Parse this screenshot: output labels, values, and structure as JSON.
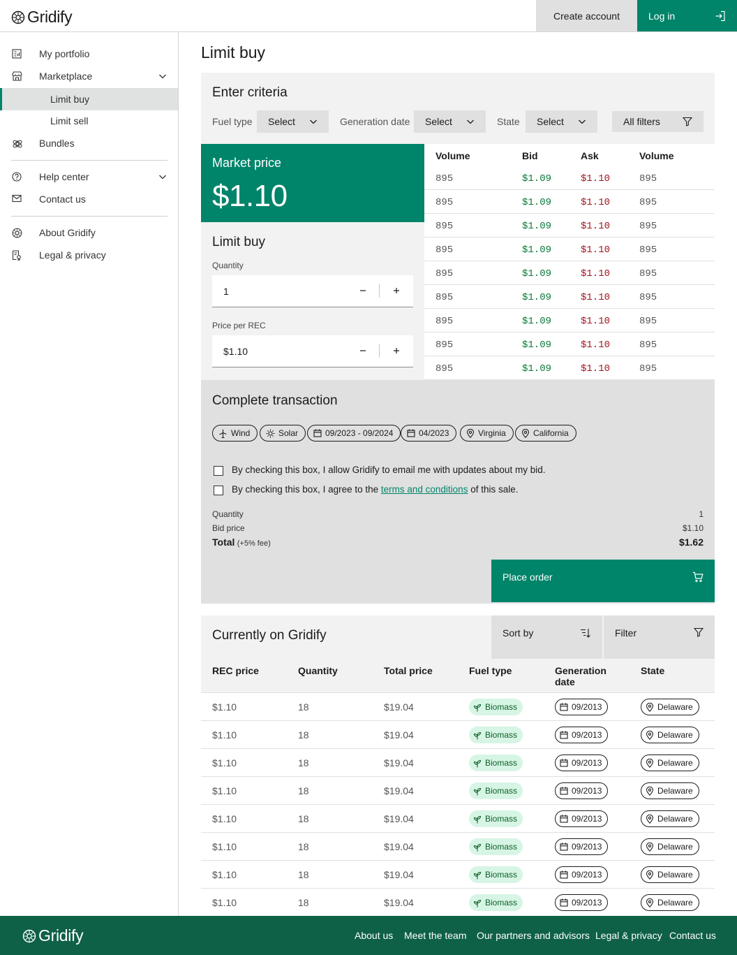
{
  "header": {
    "brand": "Gridify",
    "create_account": "Create account",
    "login": "Log in"
  },
  "sidebar": {
    "items": [
      {
        "label": "My portfolio",
        "icon": "portfolio-icon"
      },
      {
        "label": "Marketplace",
        "icon": "storefront-icon"
      },
      {
        "label": "Limit buy"
      },
      {
        "label": "Limit sell"
      },
      {
        "label": "Bundles",
        "icon": "bundles-icon"
      },
      {
        "label": "Help center",
        "icon": "help-icon"
      },
      {
        "label": "Contact us",
        "icon": "mail-icon"
      },
      {
        "label": "About Gridify",
        "icon": "gridify-logo-icon"
      },
      {
        "label": "Legal & privacy",
        "icon": "legal-icon"
      }
    ]
  },
  "page": {
    "title": "Limit buy"
  },
  "criteria": {
    "title": "Enter criteria",
    "fuel_label": "Fuel type",
    "gen_label": "Generation date",
    "state_label": "State",
    "select_text": "Select",
    "all_filters": "All filters"
  },
  "market": {
    "title": "Market price",
    "price": "$1.10"
  },
  "limit_buy": {
    "title": "Limit buy",
    "quantity_label": "Quantity",
    "quantity_value": "1",
    "price_label": "Price per REC",
    "price_value": "$1.10"
  },
  "order_book": {
    "headers": [
      "Volume",
      "Bid",
      "Ask",
      "Volume"
    ],
    "rows": [
      [
        "895",
        "$1.09",
        "$1.10",
        "895"
      ],
      [
        "895",
        "$1.09",
        "$1.10",
        "895"
      ],
      [
        "895",
        "$1.09",
        "$1.10",
        "895"
      ],
      [
        "895",
        "$1.09",
        "$1.10",
        "895"
      ],
      [
        "895",
        "$1.09",
        "$1.10",
        "895"
      ],
      [
        "895",
        "$1.09",
        "$1.10",
        "895"
      ],
      [
        "895",
        "$1.09",
        "$1.10",
        "895"
      ],
      [
        "895",
        "$1.09",
        "$1.10",
        "895"
      ],
      [
        "895",
        "$1.09",
        "$1.10",
        "895"
      ]
    ]
  },
  "transaction": {
    "title": "Complete transaction",
    "tags": [
      "Wind",
      "Solar",
      "09/2023 - 09/2024",
      "04/2023",
      "Virginia",
      "California"
    ],
    "check_email": "By checking this box, I allow Gridify to email me with updates about my bid.",
    "check_terms_pre": "By checking this box, I agree to the ",
    "check_terms_link": "terms and conditions",
    "check_terms_post": " of this sale.",
    "quantity_label": "Quantity",
    "quantity_value": "1",
    "bid_label": "Bid price",
    "bid_value": "$1.10",
    "total_label": "Total",
    "fee_note": "(+5% fee)",
    "total_value": "$1.62",
    "place_order": "Place order"
  },
  "listing": {
    "title": "Currently on Gridify",
    "sort_by": "Sort by",
    "filter": "Filter",
    "headers": [
      "REC price",
      "Quantity",
      "Total price",
      "Fuel type",
      "Generation date",
      "State"
    ],
    "rows": [
      [
        "$1.10",
        "18",
        "$19.04",
        "Biomass",
        "09/2013",
        "Delaware"
      ],
      [
        "$1.10",
        "18",
        "$19.04",
        "Biomass",
        "09/2013",
        "Delaware"
      ],
      [
        "$1.10",
        "18",
        "$19.04",
        "Biomass",
        "09/2013",
        "Delaware"
      ],
      [
        "$1.10",
        "18",
        "$19.04",
        "Biomass",
        "09/2013",
        "Delaware"
      ],
      [
        "$1.10",
        "18",
        "$19.04",
        "Biomass",
        "09/2013",
        "Delaware"
      ],
      [
        "$1.10",
        "18",
        "$19.04",
        "Biomass",
        "09/2013",
        "Delaware"
      ],
      [
        "$1.10",
        "18",
        "$19.04",
        "Biomass",
        "09/2013",
        "Delaware"
      ],
      [
        "$1.10",
        "18",
        "$19.04",
        "Biomass",
        "09/2013",
        "Delaware"
      ]
    ]
  },
  "footer": {
    "brand": "Gridify",
    "links": [
      "About us",
      "Meet the team",
      "Our partners and advisors",
      "Legal & privacy",
      "Contact us"
    ]
  },
  "colors": {
    "accent": "#00846a",
    "footer": "#0e6047",
    "bid": "#0a7a3a",
    "ask": "#a11722"
  }
}
